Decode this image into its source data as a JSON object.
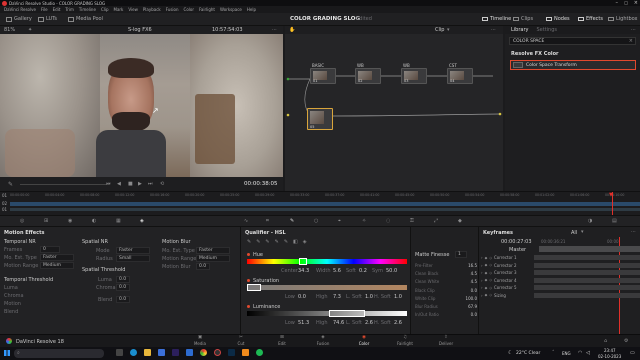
{
  "window": {
    "title": "DaVinci Resolve Studio - COLOR GRADING SLOG",
    "menu": [
      "DaVinci Resolve",
      "File",
      "Edit",
      "Trim",
      "Timeline",
      "Clip",
      "Mark",
      "View",
      "Playback",
      "Fusion",
      "Color",
      "Fairlight",
      "Workspace",
      "Help"
    ]
  },
  "toolbar": {
    "gallery": "Gallery",
    "luts": "LUTs",
    "media_pool": "Media Pool",
    "project": "COLOR GRADING SLOG",
    "edited": "Edited",
    "timeline": "Timeline",
    "clips": "Clips",
    "nodes": "Nodes",
    "effects": "Effects",
    "lightbox": "Lightbox"
  },
  "viewer": {
    "zoom": "81%",
    "clip_name": "S-log FX6",
    "tc_top": "10:57:54:03",
    "timecode": "00:00:38:05"
  },
  "node_bar": {
    "mode": "Clip"
  },
  "nodes": [
    {
      "label": "BASIC",
      "num": "01"
    },
    {
      "label": "WB",
      "num": "02"
    },
    {
      "label": "WB",
      "num": "03"
    },
    {
      "label": "CST",
      "num": "04"
    },
    {
      "label": "",
      "num": "05"
    }
  ],
  "library": {
    "tab_library": "Library",
    "tab_settings": "Settings",
    "search": "COLOR SPACE",
    "category": "Resolve FX Color",
    "item": "Color Space Transform"
  },
  "timeline": {
    "ticks": [
      "00:00:00:00",
      "00:00:04:00",
      "00:00:08:00",
      "00:00:12:00",
      "00:00:16:00",
      "00:00:20:00",
      "00:00:25:00",
      "00:00:29:00",
      "00:00:33:00",
      "00:00:37:00",
      "00:00:41:00",
      "00:00:45:00",
      "00:00:50:00",
      "00:00:54:00",
      "00:00:58:00",
      "00:01:02:00",
      "00:01:06:00",
      "00:01:10:00"
    ],
    "track1": "01",
    "track2": "02",
    "track3": "01"
  },
  "motion_effects": {
    "title": "Motion Effects",
    "temporal_nr": "Temporal NR",
    "frames": "Frames",
    "frames_val": "0",
    "mo_est_type": "Mo. Est. Type",
    "mo_est_val": "Faster",
    "motion_range": "Motion Range",
    "motion_range_val": "Medium",
    "luma": "Luma",
    "chroma": "Chroma",
    "motion": "Motion",
    "blend": "Blend",
    "temporal_threshold": "Temporal Threshold",
    "spatial_nr": "Spatial NR",
    "mode": "Mode",
    "mode_val": "Faster",
    "radius": "Radius",
    "radius_val": "Small",
    "spatial_threshold": "Spatial Threshold",
    "st_luma": "Luma",
    "st_luma_val": "0.0",
    "st_chroma": "Chroma",
    "st_chroma_val": "0.0",
    "st_blend": "Blend",
    "st_blend_val": "0.0",
    "motion_blur": "Motion Blur",
    "mb_mo_est": "Mo. Est. Type",
    "mb_mo_est_val": "Faster",
    "mb_range": "Motion Range",
    "mb_range_val": "Medium",
    "mb_blur": "Motion Blur",
    "mb_blur_val": "0.0"
  },
  "qualifier": {
    "title": "Qualifier - HSL",
    "hue": "Hue",
    "center": "Center",
    "center_val": "34.3",
    "width": "Width",
    "width_val": "5.6",
    "soft": "Soft",
    "soft_val": "0.2",
    "sym": "Sym",
    "sym_val": "50.0",
    "saturation": "Saturation",
    "luminance": "Luminance",
    "low": "Low",
    "low_val": "0.0",
    "high": "High",
    "high_val": "7.3",
    "lsoft": "L. Soft",
    "lsoft_val": "1.0",
    "hsoft": "H. Soft",
    "hsoft_val": "1.0",
    "lum_low": "51.3",
    "lum_high": "74.6",
    "lum_lsoft": "2.6",
    "lum_hsoft": "2.6"
  },
  "matte": {
    "title": "Matte Finesse",
    "page": "1",
    "pre_filter": "Pre-Filter",
    "pre_filter_val": "16.5",
    "clean_black": "Clean Black",
    "clean_black_val": "4.5",
    "clean_white": "Clean White",
    "clean_white_val": "4.5",
    "black_clip": "Black Clip",
    "black_clip_val": "0.0",
    "white_clip": "White Clip",
    "white_clip_val": "100.0",
    "blur_radius": "Blur Radius",
    "blur_radius_val": "67.9",
    "in_out_ratio": "In/Out Ratio",
    "in_out_ratio_val": "0.0"
  },
  "keyframes": {
    "title": "Keyframes",
    "filter": "All",
    "tc_left": "00:00:27:03",
    "tc_mid": "00:00:36:21",
    "tc_right": "00:00",
    "master": "Master",
    "rows": [
      "Corrector 1",
      "Corrector 2",
      "Corrector 3",
      "Corrector 4",
      "Corrector 5",
      "Sizing"
    ]
  },
  "pages": [
    "Media",
    "Cut",
    "Edit",
    "Fusion",
    "Color",
    "Fairlight",
    "Deliver"
  ],
  "active_page": "Color",
  "app_label": "DaVinci Resolve 18",
  "taskbar": {
    "weather": "22°C Clear",
    "time": "23:47",
    "date": "02-10-2023",
    "lang": "ENG"
  }
}
